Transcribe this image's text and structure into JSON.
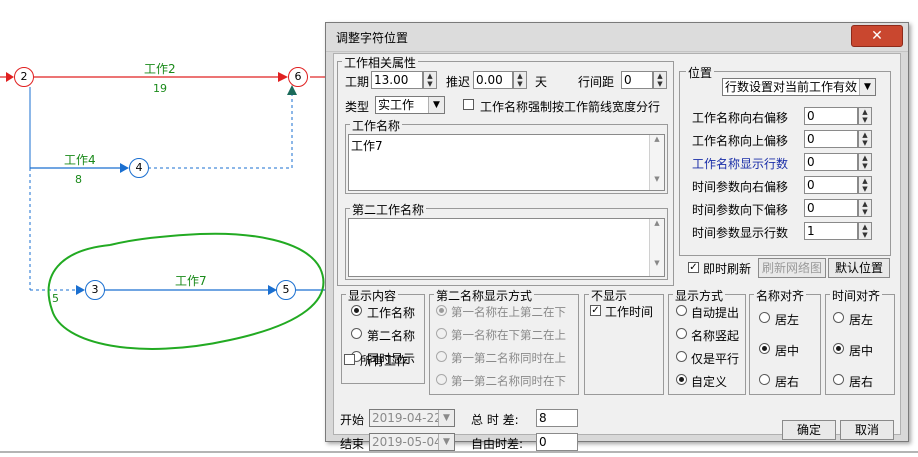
{
  "network": {
    "nodes": [
      {
        "id": "2",
        "label": "2",
        "color": "#e02020"
      },
      {
        "id": "6",
        "label": "6",
        "color": "#e02020"
      },
      {
        "id": "4",
        "label": "4",
        "color": "#1a6fd0"
      },
      {
        "id": "3",
        "label": "3",
        "color": "#1a6fd0"
      },
      {
        "id": "5",
        "label": "5",
        "color": "#1a6fd0"
      }
    ],
    "tasks": [
      {
        "name": "工作2",
        "duration": "19"
      },
      {
        "name": "工作4",
        "duration": "8"
      },
      {
        "name": "工作7",
        "duration": ""
      }
    ],
    "float_label": "5",
    "task_label_color": "#1a8a1a",
    "annotation_color": "#22aa22"
  },
  "dialog": {
    "title": "调整字符位置",
    "close_symbol": "✕",
    "work_props": {
      "legend": "工作相关属性",
      "duration_label": "工期",
      "duration_value": "13.00",
      "delay_label": "推迟",
      "delay_value": "0.00",
      "day_unit": "天",
      "row_gap_label": "行间距",
      "row_gap_value": "0",
      "type_label": "类型",
      "type_value": "实工作",
      "force_fit_label": "工作名称强制按工作箭线宽度分行",
      "name_legend": "工作名称",
      "name_value": "工作7",
      "second_name_legend": "第二工作名称",
      "second_name_value": ""
    },
    "position": {
      "legend": "位置",
      "mode_value": "行数设置对当前工作有效",
      "rows": [
        {
          "label": "工作名称向右偏移",
          "value": "0"
        },
        {
          "label": "工作名称向上偏移",
          "value": "0"
        },
        {
          "label": "工作名称显示行数",
          "value": "0"
        },
        {
          "label": "时间参数向右偏移",
          "value": "0"
        },
        {
          "label": "时间参数向下偏移",
          "value": "0"
        },
        {
          "label": "时间参数显示行数",
          "value": "1"
        }
      ],
      "instant_refresh": "即时刷新",
      "refresh_network": "刷新网络图",
      "default_position": "默认位置"
    },
    "display_content": {
      "legend": "显示内容",
      "options": [
        "工作名称",
        "第二名称",
        "同时显示"
      ],
      "selected": 0,
      "all_works": "所有工作"
    },
    "second_name_mode": {
      "legend": "第二名称显示方式",
      "options": [
        "第一名称在上第二在下",
        "第一名称在下第二在上",
        "第一第二名称同时在上",
        "第一第二名称同时在下"
      ]
    },
    "hide": {
      "legend": "不显示",
      "work_time": "工作时间"
    },
    "display_mode": {
      "legend": "显示方式",
      "options": [
        "自动提出",
        "名称竖起",
        "仅是平行",
        "自定义"
      ]
    },
    "name_align": {
      "legend": "名称对齐",
      "options": [
        "居左",
        "居中",
        "居右"
      ]
    },
    "time_align": {
      "legend": "时间对齐",
      "options": [
        "居左",
        "居中",
        "居右"
      ]
    },
    "dates": {
      "start_label": "开始",
      "start_value": "2019-04-22",
      "end_label": "结束",
      "end_value": "2019-05-04",
      "total_float_label": "总 时 差:",
      "total_float_value": "8",
      "free_float_label": "自由时差:",
      "free_float_value": "0"
    },
    "ok": "确定",
    "cancel": "取消"
  }
}
